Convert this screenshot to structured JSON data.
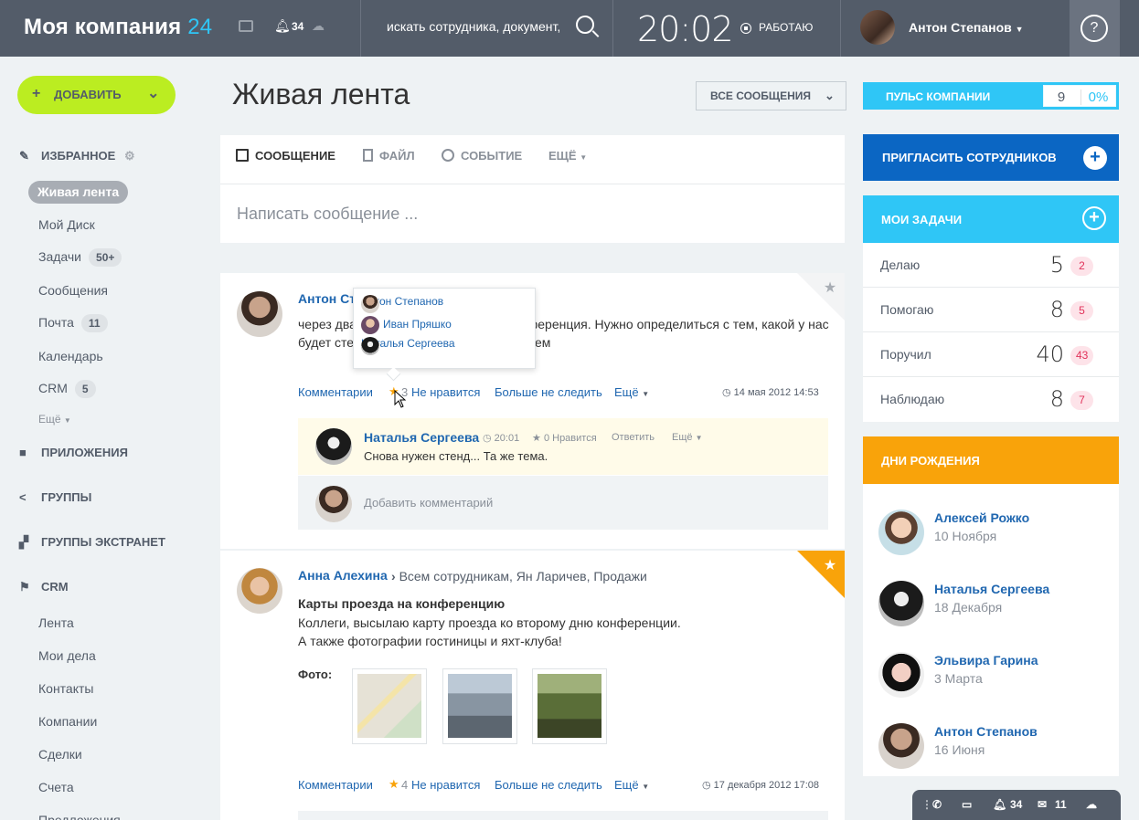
{
  "header": {
    "logo_text": "Моя компания",
    "logo_num": "24",
    "notifications_count": "34",
    "search_placeholder": "искать сотрудника, документ,",
    "clock": "20:02",
    "work_status": "РАБОТАЮ",
    "user_name": "Антон Степанов",
    "help": "?"
  },
  "sidebar": {
    "add_button": "ДОБАВИТЬ",
    "favorites": "ИЗБРАННОЕ",
    "items": [
      {
        "label": "Живая лента"
      },
      {
        "label": "Мой Диск"
      },
      {
        "label": "Задачи",
        "badge": "50+"
      },
      {
        "label": "Сообщения"
      },
      {
        "label": "Почта",
        "badge": "11"
      },
      {
        "label": "Календарь"
      },
      {
        "label": "CRM",
        "badge": "5"
      },
      {
        "label": "Ещё"
      }
    ],
    "sections": [
      "ПРИЛОЖЕНИЯ",
      "ГРУППЫ",
      "ГРУППЫ ЭКСТРАНЕТ",
      "CRM"
    ],
    "crm_items": [
      "Лента",
      "Мои дела",
      "Контакты",
      "Компании",
      "Сделки",
      "Счета",
      "Предложения"
    ]
  },
  "main": {
    "title": "Живая лента",
    "filter": "ВСЕ СООБЩЕНИЯ",
    "composer": {
      "tabs": [
        "СООБЩЕНИЕ",
        "ФАЙЛ",
        "СОБЫТИЕ",
        "ЕЩЁ"
      ],
      "placeholder": "Написать сообщение ..."
    },
    "post1": {
      "author": "Антон Ст",
      "text_line1": "через два",
      "text_line1b": "нференция. Нужно определиться с тем, какой у нас",
      "text_line2": "будет сте",
      "text_line2b": "ем",
      "actions": {
        "comments": "Комментарии",
        "likes": "3",
        "dislike": "Не нравится",
        "unfollow": "Больше не следить",
        "more": "Ещё"
      },
      "date": "14 мая 2012 14:53",
      "likers": [
        "Антон Степанов",
        "Иван Пряшко",
        "Наталья Сергеева"
      ],
      "comment": {
        "author": "Наталья Сергеева",
        "time": "20:01",
        "likes": "0",
        "like_label": "Нравится",
        "reply": "Ответить",
        "more": "Ещё",
        "text": "Снова нужен стенд... Та же тема."
      },
      "add_comment": "Добавить комментарий"
    },
    "post2": {
      "author": "Анна Алехина",
      "recipients": "Всем сотрудникам, Ян Ларичев, Продажи",
      "title": "Карты проезда на конференцию",
      "text_line1": "Коллеги, высылаю карту проезда ко второму дню конференции.",
      "text_line2": "А также фотографии гостиницы и яхт-клуба!",
      "photos_label": "Фото:",
      "actions": {
        "comments": "Комментарии",
        "likes": "4",
        "dislike": "Не нравится",
        "unfollow": "Больше не следить",
        "more": "Ещё"
      },
      "date": "17 декабря 2012 17:08"
    }
  },
  "right": {
    "pulse": {
      "label": "ПУЛЬС КОМПАНИИ",
      "value": "9",
      "percent": "0%"
    },
    "invite": "ПРИГЛАСИТЬ СОТРУДНИКОВ",
    "tasks": {
      "title": "МОИ ЗАДАЧИ",
      "rows": [
        {
          "label": "Делаю",
          "value": "5",
          "count": "2"
        },
        {
          "label": "Помогаю",
          "value": "8",
          "count": "5"
        },
        {
          "label": "Поручил",
          "value": "40",
          "count": "43"
        },
        {
          "label": "Наблюдаю",
          "value": "8",
          "count": "7"
        }
      ]
    },
    "birthdays": {
      "title": "ДНИ РОЖДЕНИЯ",
      "people": [
        {
          "name": "Алексей Рожко",
          "date": "10 Ноября"
        },
        {
          "name": "Наталья Сергеева",
          "date": "18 Декабря"
        },
        {
          "name": "Эльвира Гарина",
          "date": "3 Марта"
        },
        {
          "name": "Антон Степанов",
          "date": "16 Июня"
        }
      ]
    }
  },
  "bottombar": {
    "notifications": "34",
    "messages": "11"
  },
  "colors": {
    "header": "#535c69",
    "accent_blue": "#2fc6f6",
    "brand_blue": "#0b66c3",
    "lime": "#bbed21",
    "orange": "#f9a30a"
  }
}
